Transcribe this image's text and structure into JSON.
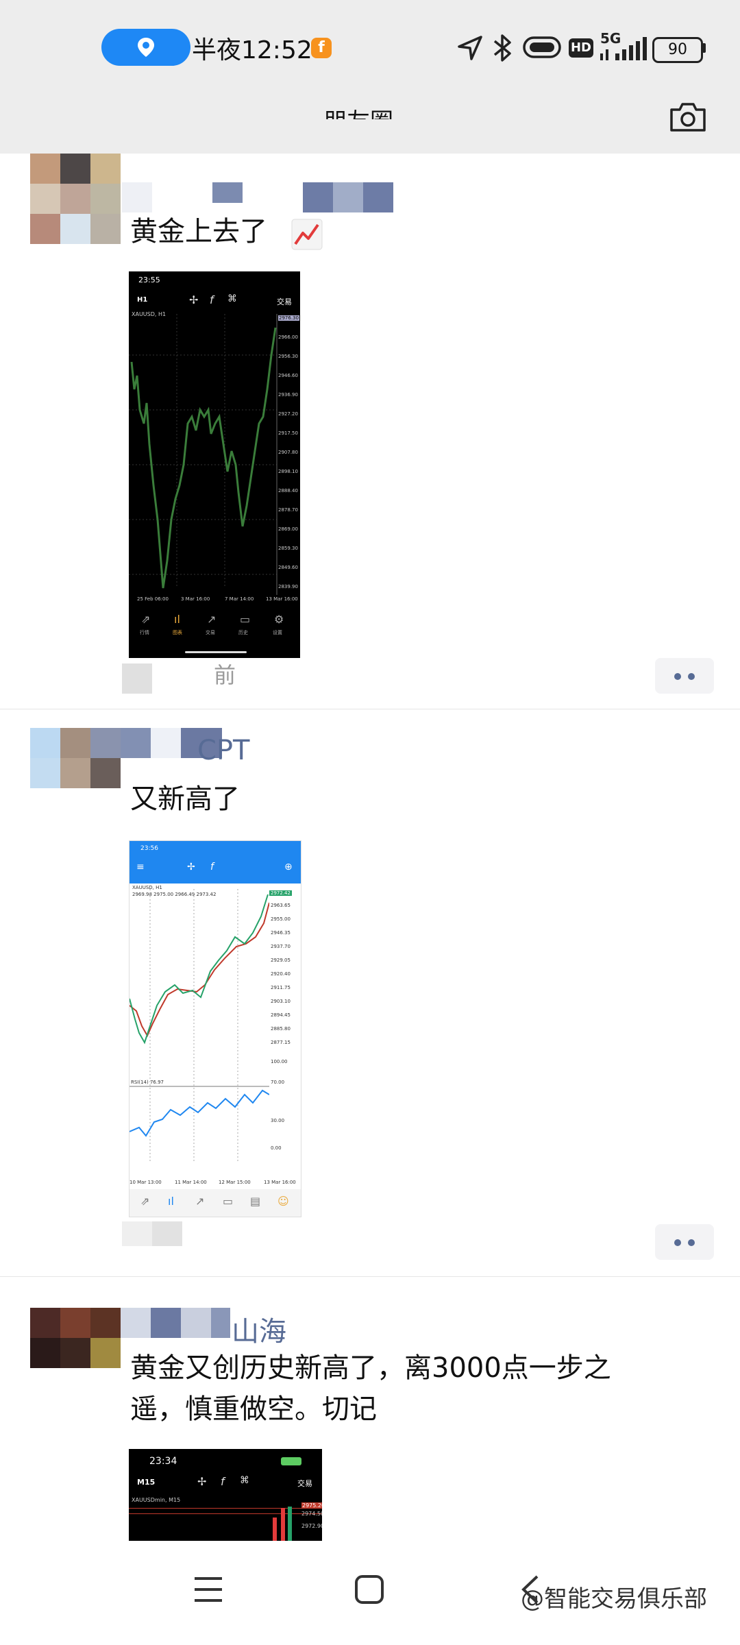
{
  "status_bar": {
    "time": "半夜12:52",
    "network": "5G",
    "hd": "HD",
    "battery": "90"
  },
  "header": {
    "title_partial": "朋友圈",
    "camera_icon": "camera-icon"
  },
  "posts": [
    {
      "text": "黄金上去了",
      "emoji": "chart-increasing-emoji",
      "time": "前",
      "chart_shot": {
        "clock": "23:55",
        "timeframe": "H1",
        "trade_label": "交易",
        "symbol": "XAUUSD, H1",
        "prices": [
          "2976.30",
          "2966.00",
          "2956.30",
          "2946.60",
          "2936.90",
          "2927.20",
          "2917.50",
          "2907.80",
          "2898.10",
          "2888.40",
          "2878.70",
          "2869.00",
          "2859.30",
          "2849.60",
          "2839.90"
        ],
        "dates": [
          "25 Feb 06:00",
          "3 Mar 16:00",
          "7 Mar 14:00",
          "13 Mar 16:00"
        ],
        "tabs": [
          "行情",
          "图表",
          "交易",
          "历史",
          "设置"
        ]
      }
    },
    {
      "name": "CPT",
      "text": "又新高了",
      "chart_shot": {
        "clock": "23:56",
        "symbol": "XAUUSD, H1",
        "ohlc": "2969.98 2975.00 2966.49 2973.42",
        "price_tag": "2972.42",
        "prices": [
          "2963.65",
          "2955.00",
          "2946.35",
          "2937.70",
          "2929.05",
          "2920.40",
          "2911.75",
          "2903.10",
          "2894.45",
          "2885.80",
          "2877.15"
        ],
        "rsi_label": "RSI(14) 76.97",
        "rsi_levels": [
          "100.00",
          "70.00",
          "30.00",
          "0.00"
        ],
        "dates": [
          "10 Mar 13:00",
          "11 Mar 14:00",
          "12 Mar 15:00",
          "13 Mar 16:00"
        ]
      }
    },
    {
      "name": "山海",
      "text_line1": "黄金又创历史新高了，离3000点一步之",
      "text_line2": "遥，慎重做空。切记",
      "chart_shot": {
        "clock": "23:34",
        "timeframe": "M15",
        "trade_label": "交易",
        "symbol": "XAUUSDmin, M15",
        "prices": [
          "2975.20",
          "2974.50",
          "2972.90"
        ]
      }
    }
  ],
  "watermark": "@智能交易俱乐部"
}
